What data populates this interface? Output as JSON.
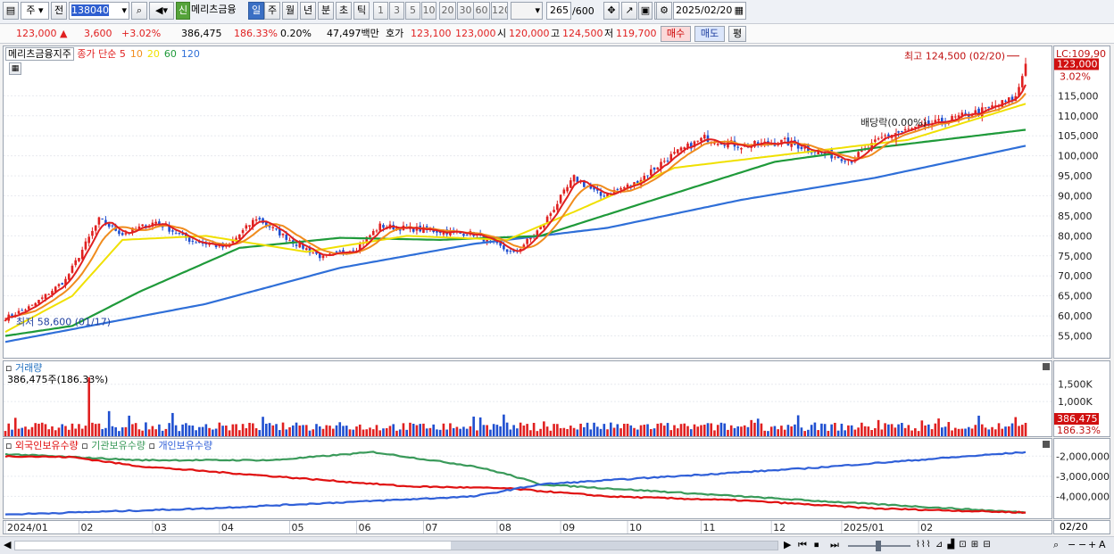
{
  "toolbar": {
    "market": "주",
    "prev": "전",
    "code": "138040",
    "name": "메리츠금융",
    "credit": "신",
    "periods": [
      "일",
      "주",
      "월",
      "년",
      "분",
      "초",
      "틱"
    ],
    "intervals": [
      "1",
      "3",
      "5",
      "10",
      "20",
      "30",
      "60",
      "120"
    ],
    "count": "265",
    "total": "/600",
    "date": "2025/02/20"
  },
  "quote": {
    "price": "123,000",
    "arrow": "▲",
    "change": "3,600",
    "pct": "+3.02%",
    "volume": "386,475",
    "vol_ratio": "186.33%",
    "turnover": "0.20%",
    "amount": "47,497백만",
    "bid_label": "호가",
    "bid1": "123,100",
    "bid2": "123,000",
    "open_label": "시",
    "open": "120,000",
    "high_label": "고",
    "high": "124,500",
    "low_label": "저",
    "low": "119,700",
    "buy": "매수",
    "sell": "매도",
    "eval": "평"
  },
  "legend": {
    "stock": "메리츠금융지주",
    "ma_label": "종가 단순",
    "ma": [
      {
        "p": "5",
        "color": "#e02020"
      },
      {
        "p": "10",
        "color": "#f08c1e"
      },
      {
        "p": "20",
        "color": "#f0e000"
      },
      {
        "p": "60",
        "color": "#1f9a3a"
      },
      {
        "p": "120",
        "color": "#2f6fd8"
      }
    ],
    "volume": "거래량",
    "volume_val": "386,475주(186.33%)",
    "holdings": [
      "외국인보유수량",
      "기관보유수량",
      "개인보유수량"
    ]
  },
  "annotations": {
    "high": "최고 124,500 (02/20)",
    "low": "최저 58,600 (01/17)",
    "dividend": "배당락(0.00%)",
    "lc": "LC:109,90",
    "price_tag": "123,000",
    "pct_tag": "3.02%",
    "vol_tag": "386,475",
    "vol_pct_tag": "186.33%",
    "end_date": "02/20"
  },
  "colors": {
    "up": "#e02020",
    "down": "#1f4fd0",
    "foreign": "#e01010",
    "inst": "#3a9a5a",
    "indiv": "#2f5fd8"
  },
  "chart_data": [
    {
      "type": "candlestick",
      "title": "메리츠금융지주",
      "x": [
        "2024/01",
        "02",
        "03",
        "04",
        "05",
        "06",
        "07",
        "08",
        "09",
        "10",
        "11",
        "12",
        "2025/01",
        "02"
      ],
      "ylim": [
        52000,
        126000
      ],
      "yticks": [
        "55,000",
        "60,000",
        "65,000",
        "70,000",
        "75,000",
        "80,000",
        "85,000",
        "90,000",
        "95,000",
        "100,000",
        "105,000",
        "110,000",
        "115,000"
      ],
      "close_keypoints": [
        [
          0,
          59500
        ],
        [
          8,
          62500
        ],
        [
          18,
          69000
        ],
        [
          28,
          84000
        ],
        [
          35,
          80500
        ],
        [
          45,
          83500
        ],
        [
          55,
          79000
        ],
        [
          66,
          77000
        ],
        [
          75,
          84500
        ],
        [
          86,
          78500
        ],
        [
          95,
          74500
        ],
        [
          105,
          77000
        ],
        [
          112,
          82500
        ],
        [
          125,
          81500
        ],
        [
          140,
          80500
        ],
        [
          152,
          75500
        ],
        [
          160,
          82000
        ],
        [
          170,
          94500
        ],
        [
          178,
          90000
        ],
        [
          188,
          93000
        ],
        [
          198,
          99500
        ],
        [
          209,
          104500
        ],
        [
          220,
          102500
        ],
        [
          233,
          103500
        ],
        [
          245,
          100500
        ],
        [
          253,
          99000
        ],
        [
          263,
          105000
        ],
        [
          280,
          108500
        ],
        [
          293,
          111500
        ],
        [
          302,
          114500
        ],
        [
          305,
          123000
        ]
      ],
      "ma_keypoints": {
        "ma20": [
          [
            0,
            56000
          ],
          [
            20,
            65000
          ],
          [
            35,
            79000
          ],
          [
            60,
            80000
          ],
          [
            90,
            76000
          ],
          [
            120,
            80000
          ],
          [
            150,
            79000
          ],
          [
            170,
            86000
          ],
          [
            200,
            97000
          ],
          [
            240,
            101000
          ],
          [
            270,
            104000
          ],
          [
            305,
            113000
          ]
        ],
        "ma60": [
          [
            0,
            55000
          ],
          [
            20,
            57500
          ],
          [
            40,
            66000
          ],
          [
            70,
            77000
          ],
          [
            100,
            79500
          ],
          [
            130,
            79000
          ],
          [
            160,
            80000
          ],
          [
            190,
            88000
          ],
          [
            230,
            98500
          ],
          [
            260,
            102000
          ],
          [
            305,
            106500
          ]
        ],
        "ma120": [
          [
            0,
            53500
          ],
          [
            60,
            63000
          ],
          [
            100,
            72000
          ],
          [
            140,
            78000
          ],
          [
            180,
            82000
          ],
          [
            220,
            89000
          ],
          [
            260,
            94500
          ],
          [
            305,
            102500
          ]
        ]
      }
    },
    {
      "type": "bar",
      "title": "거래량",
      "yticks": [
        "1,000K",
        "1,500K"
      ],
      "max_keypoint": [
        [
          25,
          1700000
        ]
      ]
    },
    {
      "type": "line",
      "title": "보유수량",
      "yticks": [
        "-2,000,000",
        "-3,000,000",
        "-4,000,000"
      ],
      "series": [
        {
          "name": "외국인보유수량",
          "keypoints": [
            [
              0,
              -2000000
            ],
            [
              20,
              -2050000
            ],
            [
              40,
              -2500000
            ],
            [
              80,
              -3000000
            ],
            [
              120,
              -3500000
            ],
            [
              150,
              -3600000
            ],
            [
              180,
              -4000000
            ],
            [
              220,
              -4200000
            ],
            [
              260,
              -4600000
            ],
            [
              305,
              -4800000
            ]
          ]
        },
        {
          "name": "기관보유수량",
          "keypoints": [
            [
              0,
              -1900000
            ],
            [
              40,
              -2200000
            ],
            [
              80,
              -2200000
            ],
            [
              110,
              -1800000
            ],
            [
              140,
              -2500000
            ],
            [
              150,
              -2900000
            ],
            [
              160,
              -3400000
            ],
            [
              200,
              -3800000
            ],
            [
              240,
              -4200000
            ],
            [
              305,
              -4800000
            ]
          ]
        },
        {
          "name": "개인보유수량",
          "keypoints": [
            [
              0,
              -4900000
            ],
            [
              60,
              -4600000
            ],
            [
              100,
              -4300000
            ],
            [
              140,
              -4000000
            ],
            [
              160,
              -3400000
            ],
            [
              200,
              -3000000
            ],
            [
              240,
              -2600000
            ],
            [
              280,
              -2100000
            ],
            [
              305,
              -1800000
            ]
          ]
        }
      ]
    }
  ]
}
